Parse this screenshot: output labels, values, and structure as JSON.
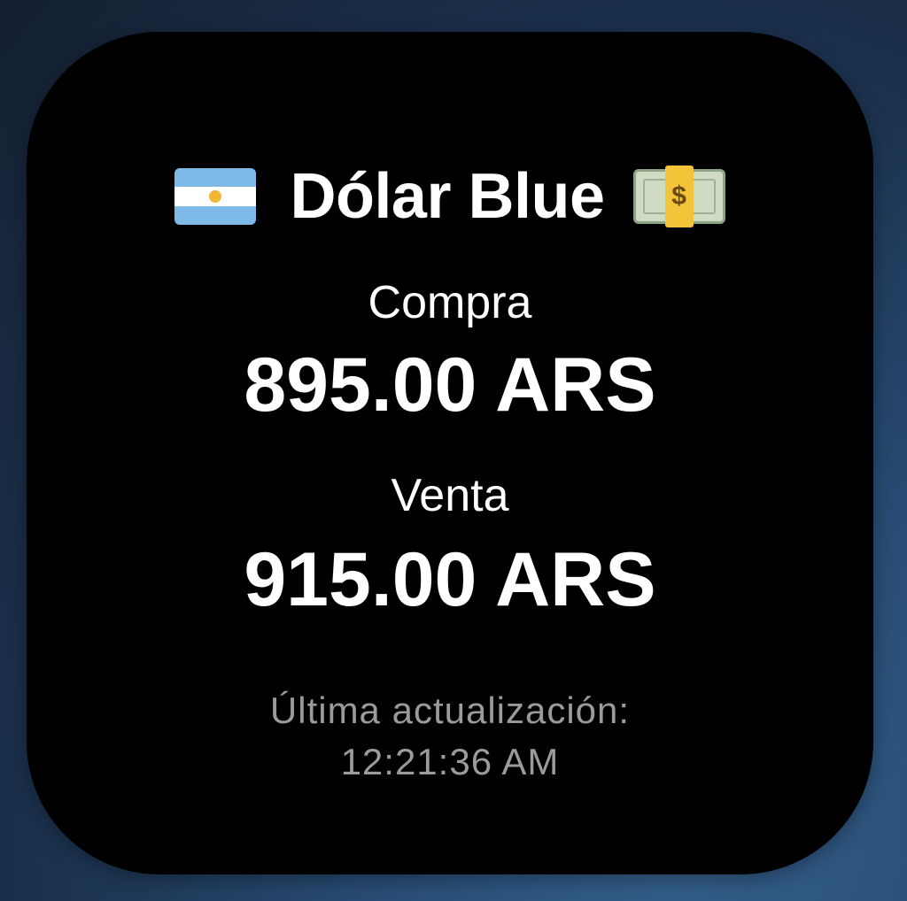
{
  "widget": {
    "title": "Dólar Blue",
    "flag_icon": "argentina-flag-icon",
    "money_icon": "money-bag-icon",
    "compra": {
      "label": "Compra",
      "value": "895.00 ARS"
    },
    "venta": {
      "label": "Venta",
      "value": "915.00 ARS"
    },
    "update": {
      "label": "Última actualización:",
      "time": "12:21:36 AM"
    }
  },
  "colors": {
    "widget_background": "#000000",
    "text_primary": "#ffffff",
    "text_secondary": "#9b9b9b",
    "wallpaper": "#284b73"
  }
}
